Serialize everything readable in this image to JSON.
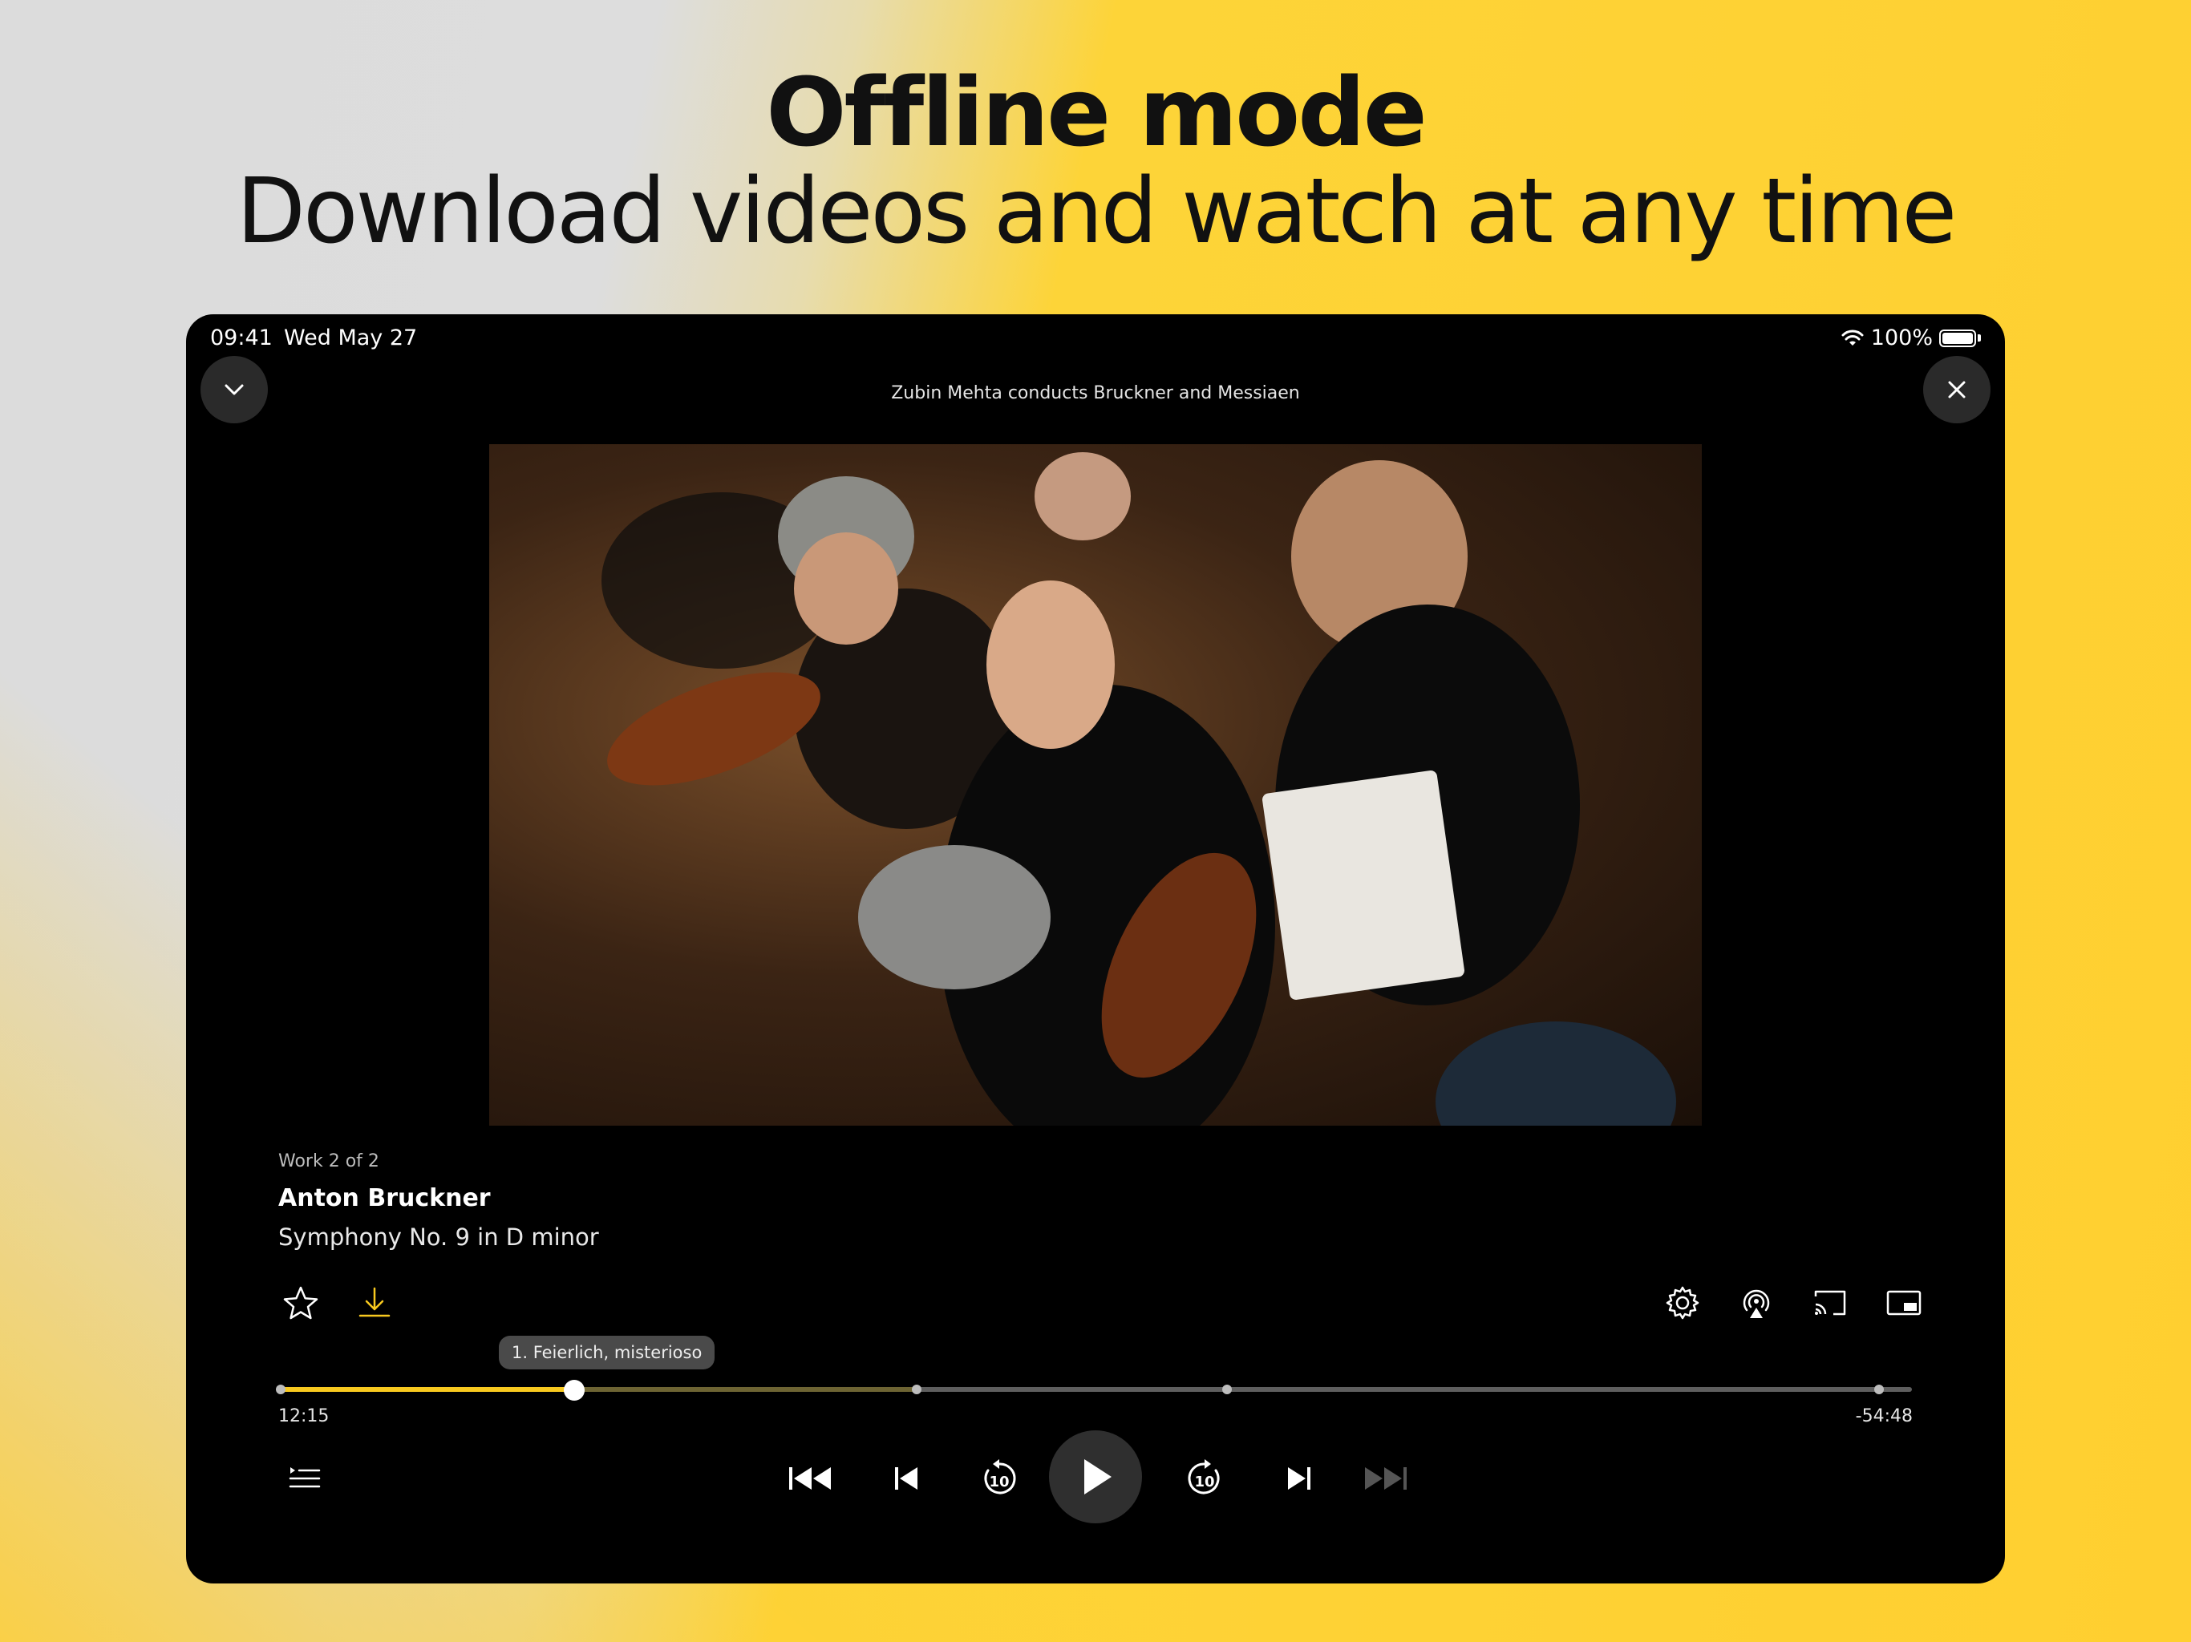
{
  "headline": {
    "title": "Offline mode",
    "subtitle": "Download videos and watch at any time"
  },
  "status_bar": {
    "time": "09:41",
    "date": "Wed May 27",
    "battery": "100%"
  },
  "player": {
    "title": "Zubin Mehta conducts Bruckner and Messiaen",
    "work_index": "Work 2 of 2",
    "composer": "Anton Bruckner",
    "piece": "Symphony No. 9 in D minor",
    "chapter_tooltip": "1. Feierlich, misterioso",
    "elapsed": "12:15",
    "remaining": "-54:48",
    "progress_fraction": 0.18,
    "buffered_fraction": 0.39,
    "chapter_marks": [
      0.0,
      0.39,
      0.58,
      0.98
    ]
  },
  "icons": {
    "collapse": "chevron-down-icon",
    "close": "close-icon",
    "favorite": "star-icon",
    "download": "download-icon",
    "settings": "gear-icon",
    "airplay": "airplay-icon",
    "cast": "cast-icon",
    "pip": "picture-in-picture-icon",
    "playlist": "playlist-icon"
  },
  "colors": {
    "accent": "#f8c91f",
    "background_yellow": "#ffcf30",
    "background_gray": "#dddddd",
    "player_bg": "#000000"
  }
}
